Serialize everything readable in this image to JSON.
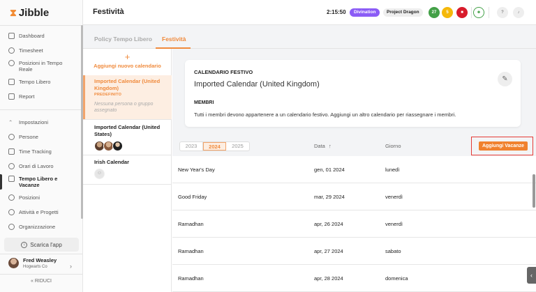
{
  "app": {
    "logo": "Jibble"
  },
  "sidebar": {
    "items_top": [
      {
        "label": "Dashboard",
        "icon": "dashboard-icon"
      },
      {
        "label": "Timesheet",
        "icon": "clock-icon"
      },
      {
        "label": "Posizioni in Tempo Reale",
        "icon": "location-pin-icon"
      },
      {
        "label": "Tempo Libero",
        "icon": "suitcase-icon"
      },
      {
        "label": "Report",
        "icon": "report-icon"
      }
    ],
    "settings_label": "Impostazioni",
    "items_settings": [
      {
        "label": "Persone",
        "icon": "people-icon"
      },
      {
        "label": "Time Tracking",
        "icon": "tracking-icon"
      },
      {
        "label": "Orari di Lavoro",
        "icon": "clock-icon"
      },
      {
        "label": "Tempo Libero e Vacanze",
        "icon": "suitcase-icon",
        "active": true
      },
      {
        "label": "Posizioni",
        "icon": "location-pin-icon"
      },
      {
        "label": "Attività e Progetti",
        "icon": "tag-icon"
      },
      {
        "label": "Organizzazione",
        "icon": "gear-icon"
      }
    ],
    "download_label": "Scarica l'app",
    "user": {
      "name": "Fred Weasley",
      "org": "Hogwarts Co"
    },
    "collapse_label": "RIDUCI"
  },
  "header": {
    "title": "Festività",
    "timer": "2:15:50",
    "activity_badge": "Divination",
    "project_badge": "Project Dragon",
    "circles": [
      {
        "text": "27",
        "color": "#43a047"
      },
      {
        "text": "5",
        "color": "#f5b80a"
      },
      {
        "text": "■",
        "color": "#d81b2b"
      }
    ]
  },
  "tabs": [
    {
      "label": "Policy Tempo Libero",
      "active": false
    },
    {
      "label": "Festività",
      "active": true
    }
  ],
  "calendars": {
    "add_label": "Aggiungi nuovo calendario",
    "items": [
      {
        "name": "Imported Calendar (United Kingdom)",
        "tag": "PREDEFINITO",
        "empty_text": "Nessuna persona o gruppo assegnato"
      },
      {
        "name": "Imported Calendar (United States)"
      },
      {
        "name": "Irish Calendar"
      }
    ]
  },
  "detail": {
    "heading": "CALENDARIO FESTIVO",
    "calendar_name": "Imported Calendar (United Kingdom)",
    "members_heading": "MEMBRI",
    "members_text": "Tutti i membri devono appartenere a un calendario festivo. Aggiungi un altro calendario per riassegnare i membri."
  },
  "years": {
    "options": [
      "2023",
      "2024",
      "2025"
    ],
    "selected": "2024"
  },
  "table": {
    "col_date": "Data",
    "col_day": "Giorno",
    "add_button": "Aggiungi Vacanze",
    "rows": [
      {
        "name": "New Year's Day",
        "date": "gen, 01 2024",
        "day": "lunedì"
      },
      {
        "name": "Good Friday",
        "date": "mar, 29 2024",
        "day": "venerdì"
      },
      {
        "name": "Ramadhan",
        "date": "apr, 26 2024",
        "day": "venerdì"
      },
      {
        "name": "Ramadhan",
        "date": "apr, 27 2024",
        "day": "sabato"
      },
      {
        "name": "Ramadhan",
        "date": "apr, 28 2024",
        "day": "domenica"
      }
    ]
  }
}
